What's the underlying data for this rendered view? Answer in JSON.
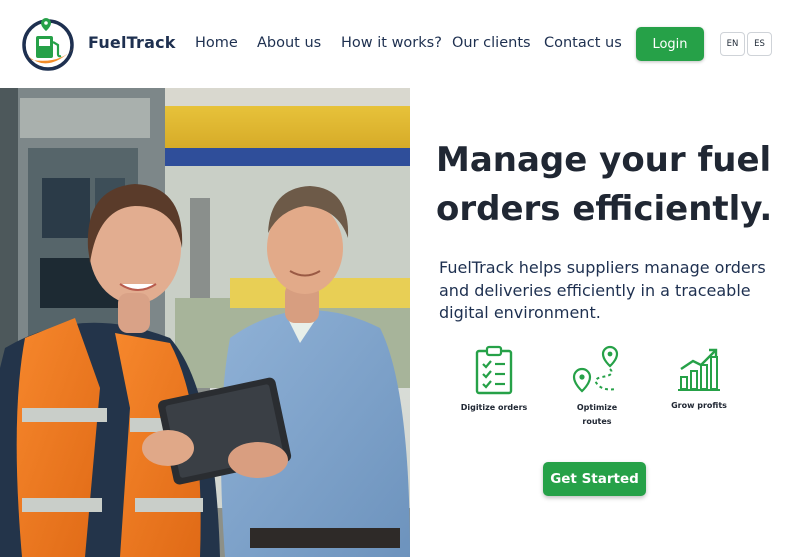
{
  "brand": {
    "name": "FuelTrack",
    "accent": "#26a148",
    "navy": "#1e3050",
    "orange": "#f28c28"
  },
  "nav": {
    "items": [
      {
        "label": "Home"
      },
      {
        "label": "About us"
      },
      {
        "label": "How it works?"
      },
      {
        "label": "Our clients"
      },
      {
        "label": "Contact us"
      }
    ],
    "login_label": "Login",
    "languages": [
      "EN",
      "ES"
    ]
  },
  "hero": {
    "headline_lines": [
      "Manage your fuel",
      "orders efficiently."
    ],
    "description_lines": [
      "FuelTrack helps suppliers manage orders",
      "and deliveries efficiently in a traceable",
      "digital environment."
    ],
    "features": [
      {
        "icon": "clipboard-checklist-icon",
        "label_lines": [
          "Digitize orders"
        ]
      },
      {
        "icon": "route-pins-icon",
        "label_lines": [
          "Optimize",
          "routes"
        ]
      },
      {
        "icon": "growth-chart-icon",
        "label_lines": [
          "Grow profits"
        ]
      }
    ],
    "cta_label": "Get Started",
    "image": "fuel-station-workers-with-tablet"
  }
}
